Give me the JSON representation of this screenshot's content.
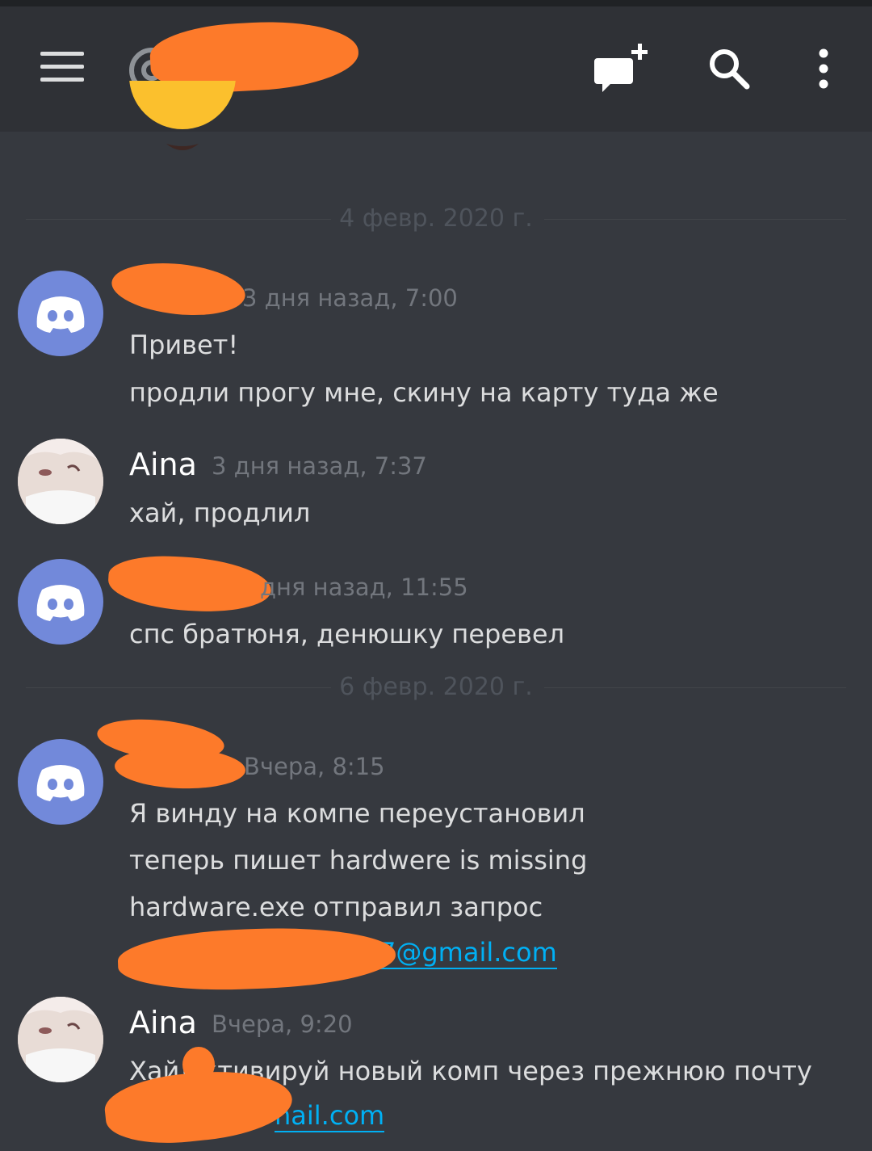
{
  "header": {
    "menu_icon": "hamburger-menu-icon",
    "mention_icon": "at-icon",
    "new_dm_icon": "new-message-icon",
    "search_icon": "search-icon",
    "more_icon": "more-vertical-icon"
  },
  "colors": {
    "background": "#36393f",
    "header": "#2f3136",
    "discord_blurple": "#7289da",
    "link": "#00b0f4",
    "redaction": "#fd7a2a"
  },
  "dates": [
    "4 февр. 2020 г.",
    "6 февр. 2020 г."
  ],
  "messages": [
    {
      "author": "",
      "avatar": "discord-default-avatar",
      "timestamp": "3 дня назад, 7:00",
      "lines": [
        "Привет!",
        "продли прогу мне, скину на карту туда же"
      ]
    },
    {
      "author": "Aina",
      "avatar": "user-photo-avatar",
      "timestamp": "3 дня назад, 7:37",
      "lines": [
        "хай, продлил"
      ]
    },
    {
      "author": "",
      "avatar": "discord-default-avatar",
      "timestamp": "дня назад, 11:55",
      "lines": [
        "спс братюня, денюшку перевел"
      ]
    },
    {
      "author": "",
      "avatar": "discord-default-avatar",
      "timestamp": "Вчера, 8:15",
      "lines": [
        "Я винду на компе переустановил",
        "теперь пишет hardwere is missing",
        "hardware.exe   отправил запрос"
      ],
      "link": "7@gmail.com"
    },
    {
      "author": "Aina",
      "avatar": "user-photo-avatar",
      "timestamp": "Вчера, 9:20",
      "lines": [
        "Хай!",
        "ктивируй новый комп через прежнюю почту"
      ],
      "link": "nail.com"
    }
  ]
}
